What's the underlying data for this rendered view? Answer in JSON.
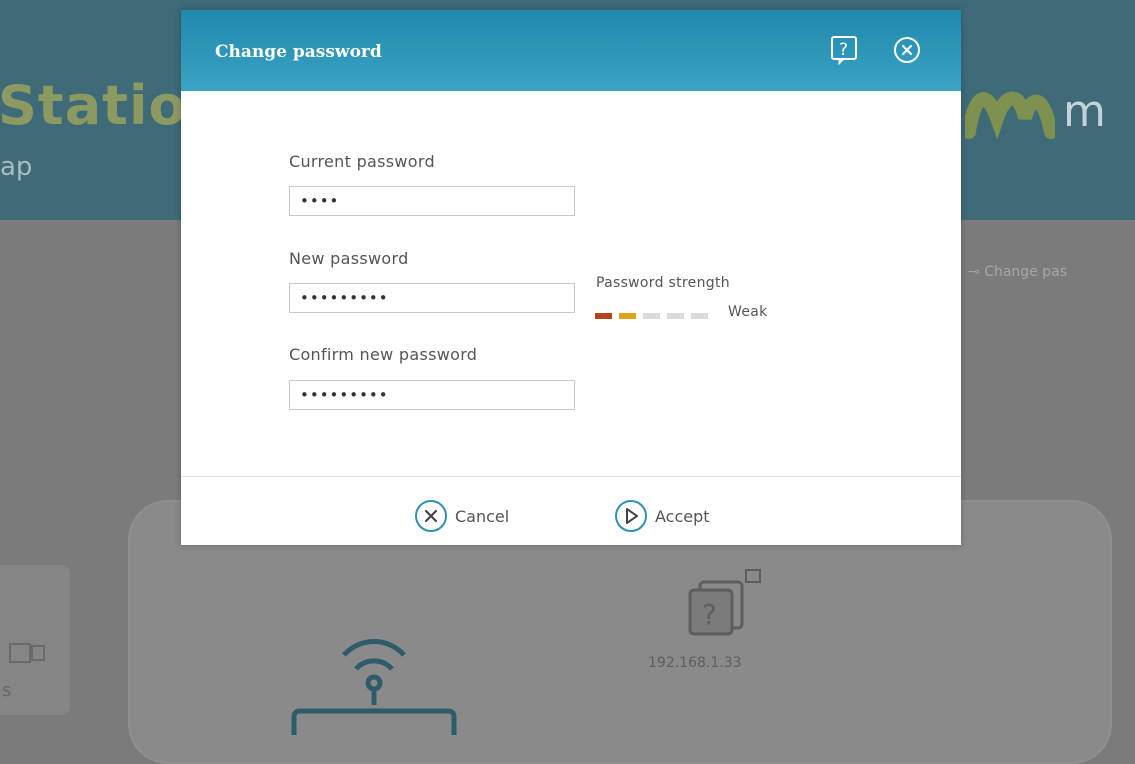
{
  "background": {
    "brand_text": "Statio",
    "sub_text": "ap",
    "logo_text": "m",
    "change_password_link": "Change pas",
    "device_ip": "192.168.1.33",
    "left_card_text": "s",
    "colors": {
      "header": "#3f6a78",
      "body": "#7b7b7b"
    }
  },
  "dialog": {
    "title": "Change password",
    "icons": {
      "help": "help-icon",
      "close": "close-icon"
    },
    "current_password": {
      "label": "Current password",
      "value": "••••"
    },
    "new_password": {
      "label": "New password",
      "value": "•••••••••"
    },
    "confirm_password": {
      "label": "Confirm new password",
      "value": "•••••••••"
    },
    "strength": {
      "label": "Password strength",
      "value": "Weak",
      "segments_total": 5,
      "segments_filled": 2,
      "colors": [
        "#b4441c",
        "#e0a41c",
        "#dadada",
        "#dadada",
        "#dadada"
      ]
    },
    "buttons": {
      "cancel": "Cancel",
      "accept": "Accept"
    },
    "colors": {
      "header": "#1f88ad",
      "text": "#555555"
    }
  }
}
